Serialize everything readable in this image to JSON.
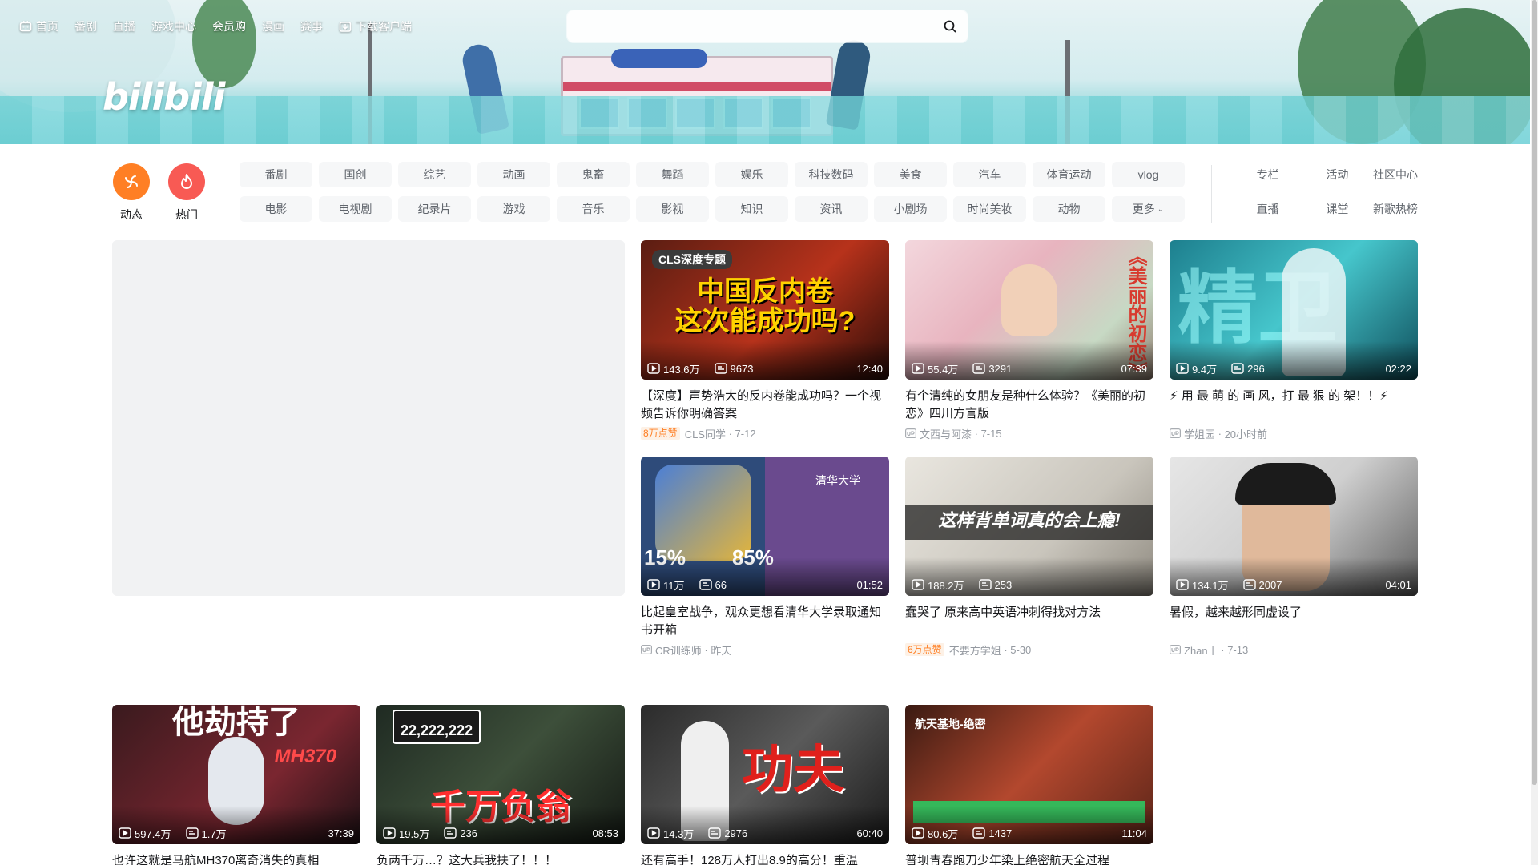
{
  "colors": {
    "brand_pink": "#fb7299",
    "accent_blue": "#00aeec",
    "dynamic_orange": "#ff7f24",
    "hot_red": "#f85a54",
    "text_gray": "#61666d",
    "muted": "#9499a0"
  },
  "topnav": {
    "items": [
      {
        "label": "首页",
        "icon": "tv-icon"
      },
      {
        "label": "番剧"
      },
      {
        "label": "直播"
      },
      {
        "label": "游戏中心"
      },
      {
        "label": "会员购"
      },
      {
        "label": "漫画"
      },
      {
        "label": "赛事"
      },
      {
        "label": "下载客户端",
        "icon": "download-icon"
      }
    ]
  },
  "search": {
    "placeholder": "",
    "value": "",
    "icon": "search-icon"
  },
  "logo": {
    "text": "bilibili"
  },
  "quick": {
    "dynamic": {
      "label": "动态",
      "icon": "dynamic-icon"
    },
    "hot": {
      "label": "热门",
      "icon": "fire-icon"
    }
  },
  "channels": {
    "row1": [
      "番剧",
      "国创",
      "综艺",
      "动画",
      "鬼畜",
      "舞蹈",
      "娱乐",
      "科技数码",
      "美食",
      "汽车",
      "体育运动",
      "vlog"
    ],
    "row2": [
      "电影",
      "电视剧",
      "纪录片",
      "游戏",
      "音乐",
      "影视",
      "知识",
      "资讯",
      "小剧场",
      "时尚美妆",
      "动物",
      "更多"
    ]
  },
  "extra_links": [
    "专栏",
    "活动",
    "社区中心",
    "直播",
    "课堂",
    "新歌热榜"
  ],
  "cards": [
    {
      "thumb_caption": "中国反内卷\n这次能成功吗?",
      "thumb_tag": "CLS深度专题",
      "views": "143.6万",
      "danmaku": "9673",
      "duration": "12:40",
      "title": "【深度】声势浩大的反内卷能成功吗？一个视频告诉你明确答案",
      "badge": "8万点赞",
      "up": "CLS同学",
      "date": "7-12"
    },
    {
      "thumb_caption": "《美丽的初恋》",
      "thumb_tag": "",
      "views": "55.4万",
      "danmaku": "3291",
      "duration": "07:39",
      "title": "有个清纯的女朋友是种什么体验？《美丽的初恋》四川方言版",
      "badge": "",
      "up": "文西与阿漆",
      "date": "7-15"
    },
    {
      "thumb_caption": "精卫",
      "thumb_tag": "",
      "views": "9.4万",
      "danmaku": "296",
      "duration": "02:22",
      "title": "⚡ 用 最 萌 的 画 风，打 最 狠 的 架！！⚡",
      "badge": "",
      "up": "学姐园",
      "date": "20小时前"
    },
    {
      "thumb_caption": "15%        85%",
      "thumb_tag": "清华大学",
      "views": "11万",
      "danmaku": "66",
      "duration": "01:52",
      "title": "比起皇室战争，观众更想看清华大学录取通知书开箱",
      "badge": "",
      "up": "CR训练师",
      "date": "昨天"
    },
    {
      "thumb_caption": "这样背单词真的会上瘾!",
      "thumb_tag": "",
      "views": "188.2万",
      "danmaku": "253",
      "duration": "",
      "title": "蠢哭了 原来高中英语冲刺得找对方法",
      "badge": "6万点赞",
      "up": "不要方学姐",
      "date": "5-30"
    },
    {
      "thumb_caption": "",
      "thumb_tag": "",
      "views": "134.1万",
      "danmaku": "2007",
      "duration": "04:01",
      "title": "暑假，越来越形同虚设了",
      "badge": "",
      "up": "Zhan丨",
      "date": "7-13"
    },
    {
      "thumb_caption": "他劫持了",
      "thumb_tag": "MH370",
      "views": "597.4万",
      "danmaku": "1.7万",
      "duration": "37:39",
      "title": "也许这就是马航MH370离奇消失的真相",
      "badge": "",
      "up": "",
      "date": ""
    },
    {
      "thumb_caption": "千万负翁",
      "thumb_tag": "22,222,222",
      "views": "19.5万",
      "danmaku": "236",
      "duration": "08:53",
      "title": "负两千万…？这大兵我扶了！！！",
      "badge": "",
      "up": "",
      "date": ""
    },
    {
      "thumb_caption": "功夫",
      "thumb_tag": "",
      "views": "14.3万",
      "danmaku": "2976",
      "duration": "60:40",
      "title": "还有高手！128万人打出8.9的高分！重温",
      "badge": "",
      "up": "",
      "date": ""
    },
    {
      "thumb_caption": "航天基地-绝密",
      "thumb_tag": "",
      "views": "80.6万",
      "danmaku": "1437",
      "duration": "11:04",
      "title": "普坝青春跑刀少年染上绝密航天全过程",
      "badge": "",
      "up": "",
      "date": ""
    }
  ]
}
